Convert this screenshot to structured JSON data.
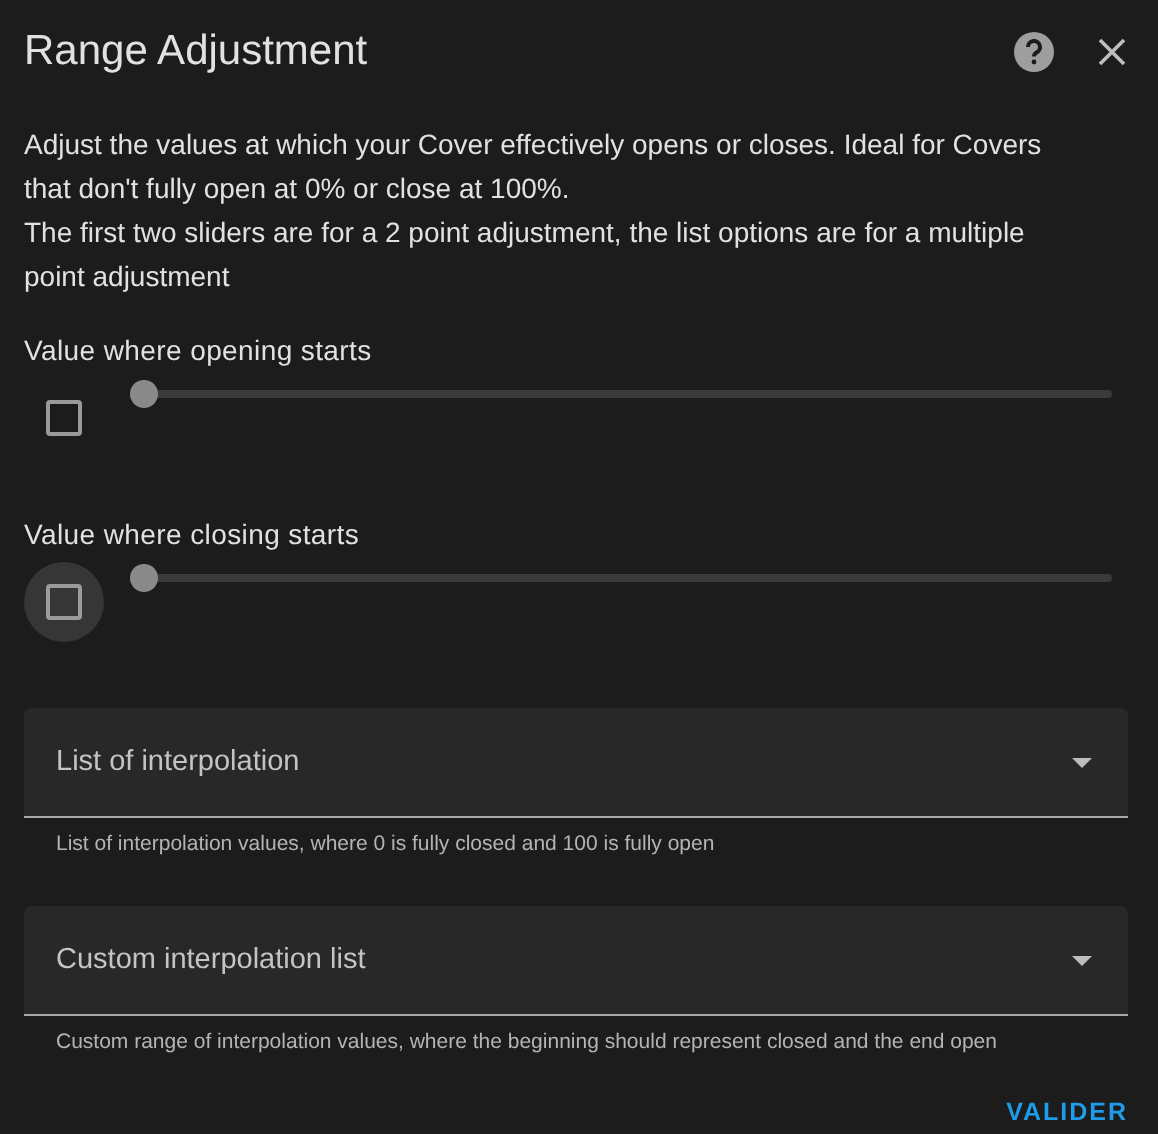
{
  "dialog": {
    "title": "Range Adjustment"
  },
  "description": [
    "Adjust the values at which your Cover effectively opens or closes. Ideal for Covers that don't fully open at 0% or close at 100%.",
    "The first two sliders are for a 2 point adjustment, the list options are for a multiple point adjustment"
  ],
  "sliders": [
    {
      "label": "Value where opening starts",
      "checked": false,
      "focused": false,
      "level": 0
    },
    {
      "label": "Value where closing starts",
      "checked": false,
      "focused": true,
      "level": 0
    }
  ],
  "selects": [
    {
      "label": "List of interpolation",
      "helper": "List of interpolation values, where 0 is fully closed and 100 is fully open"
    },
    {
      "label": "Custom interpolation list",
      "helper": "Custom range of interpolation values, where the beginning should represent closed and the end open"
    }
  ],
  "buttons": [
    "VALIDER"
  ]
}
